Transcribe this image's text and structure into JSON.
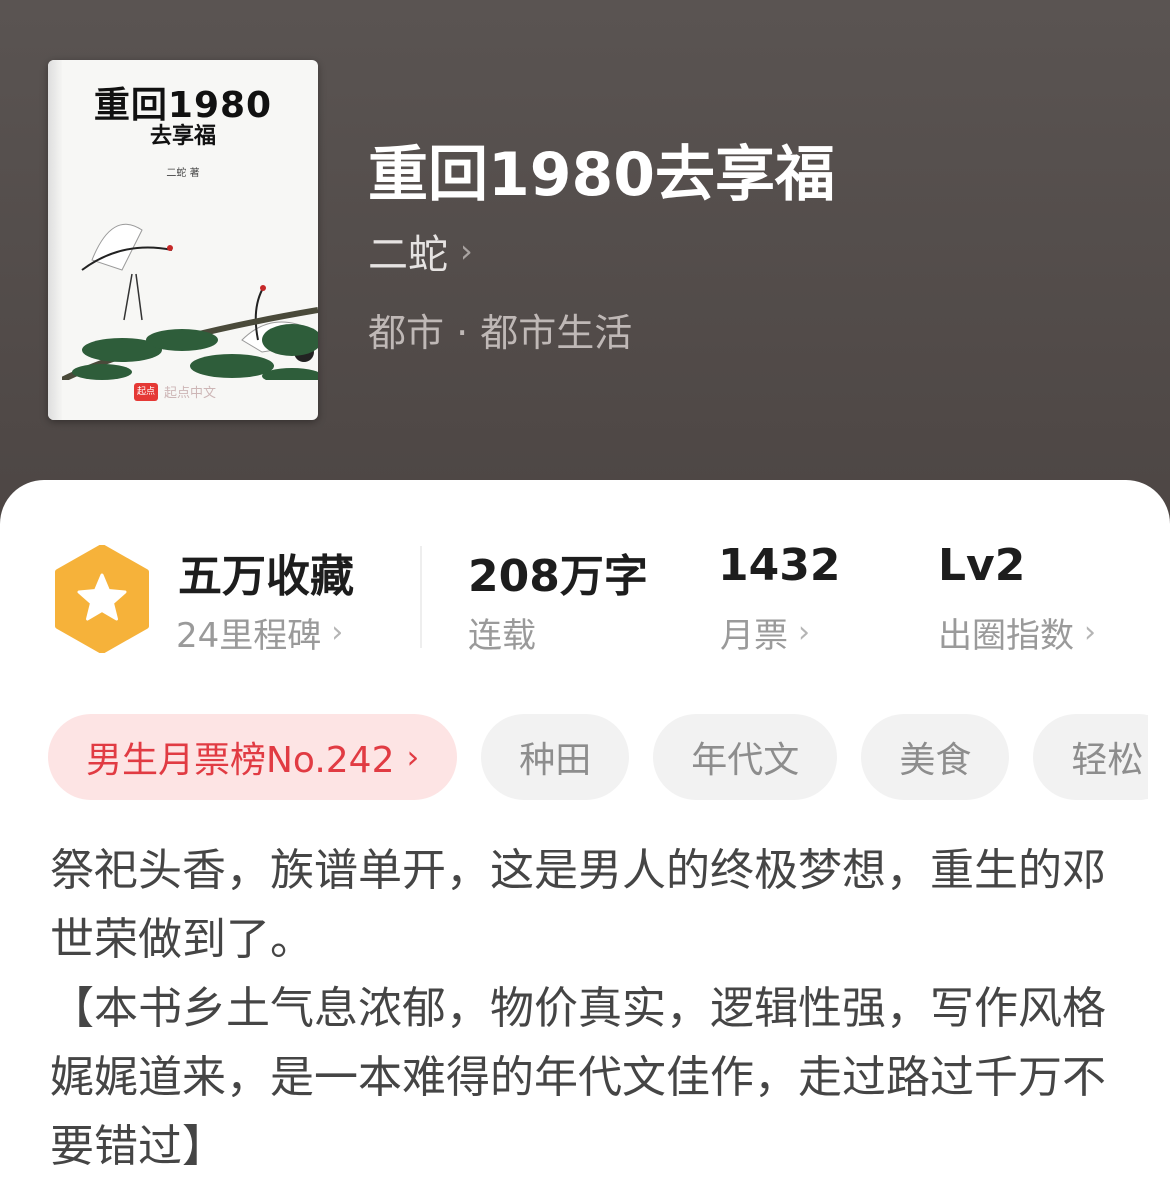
{
  "book": {
    "title": "重回1980去享福",
    "author": "二蛇",
    "genre": "都市 · 都市生活",
    "cover": {
      "title": "重回1980",
      "subtitle": "去享福",
      "author": "二蛇 著",
      "publisher_logo": "起点",
      "publisher": "起点中文"
    }
  },
  "stats": {
    "collect": {
      "value": "五万收藏",
      "label": "24里程碑"
    },
    "words": {
      "value": "208万字",
      "label": "连载"
    },
    "tickets": {
      "value": "1432",
      "label": "月票"
    },
    "level": {
      "value": "Lv2",
      "label": "出圈指数"
    }
  },
  "tags": {
    "rank": "男生月票榜No.242",
    "items": [
      "种田",
      "年代文",
      "美食",
      "轻松"
    ]
  },
  "description": [
    "祭祀头香，族谱单开，这是男人的终极梦想，重生的邓世荣做到了。",
    "【本书乡土气息浓郁，物价真实，逻辑性强，写作风格娓娓道来，是一本难得的年代文佳作，走过路过千万不要错过】"
  ],
  "icons": {
    "badge": "star-hexagon-icon",
    "chevron": "chevron-right-icon"
  },
  "colors": {
    "header_bg": "#524b49",
    "rank_tag_bg": "#fde4e4",
    "rank_tag_text": "#e13b43",
    "badge": "#f6b23a"
  }
}
